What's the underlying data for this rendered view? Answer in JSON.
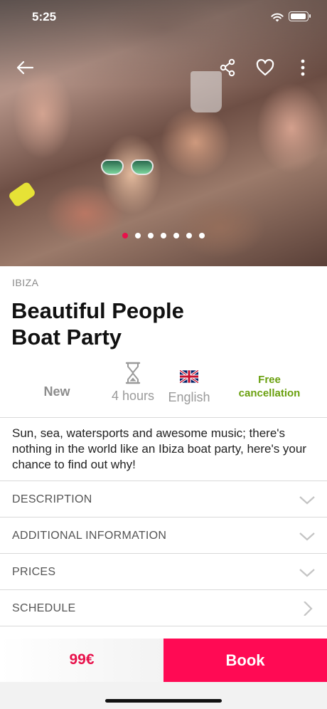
{
  "status_bar": {
    "time": "5:25"
  },
  "hero": {
    "image_alt": "Boat party crowd",
    "carousel": {
      "count": 7,
      "active_index": 0
    }
  },
  "nav": {
    "back_icon": "arrow-left-icon",
    "share_icon": "share-icon",
    "favorite_icon": "heart-icon",
    "more_icon": "more-vertical-icon"
  },
  "activity": {
    "city": "IBIZA",
    "title_line1": "Beautiful People",
    "title_line2": "Boat Party"
  },
  "features": {
    "new_label": "New",
    "duration": "4 hours",
    "language": "English",
    "cancel_line1": "Free",
    "cancel_line2": "cancellation"
  },
  "summary": "Sun, sea, watersports and awesome music; there's nothing in the world like an Ibiza boat party, here's your chance to find out why!",
  "sections": [
    {
      "label": "DESCRIPTION",
      "icon": "chevron-down-icon"
    },
    {
      "label": "ADDITIONAL INFORMATION",
      "icon": "chevron-down-icon"
    },
    {
      "label": "PRICES",
      "icon": "chevron-down-icon"
    },
    {
      "label": "SCHEDULE",
      "icon": "chevron-right-icon"
    }
  ],
  "booking": {
    "price": "99€",
    "book_label": "Book"
  },
  "colors": {
    "accent": "#ff0a54",
    "price": "#e8114b",
    "free_cancellation": "#6aa00f"
  }
}
